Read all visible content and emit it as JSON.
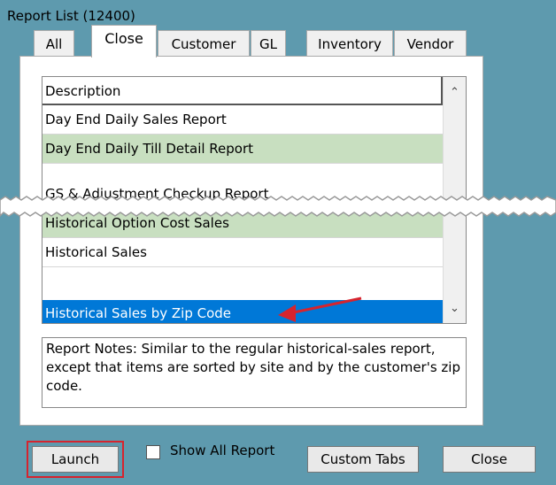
{
  "window": {
    "title": "Report List (12400)"
  },
  "tabs": [
    {
      "label": "All"
    },
    {
      "label": "Close"
    },
    {
      "label": "Customer"
    },
    {
      "label": "GL"
    },
    {
      "label": "Inventory"
    },
    {
      "label": "Vendor"
    }
  ],
  "list": {
    "header": "Description",
    "rows": [
      {
        "label": "Day End Daily Sales Report",
        "style": "white"
      },
      {
        "label": "Day End Daily Till Detail Report",
        "style": "green"
      },
      {
        "label": "GS & Adjustment Checkup Report",
        "style": "white"
      },
      {
        "label": "Historical Option Cost Sales",
        "style": "green"
      },
      {
        "label": "Historical Sales",
        "style": "white"
      },
      {
        "label": "Historical Sales by Zip Code",
        "style": "selected"
      }
    ]
  },
  "notes": {
    "text": "Report Notes:  Similar to the regular historical-sales report, except that items are sorted by site and by the customer's zip code."
  },
  "buttons": {
    "launch": "Launch",
    "show_all": "Show All Report",
    "custom_tabs": "Custom Tabs",
    "close": "Close"
  },
  "colors": {
    "title_bg": "#5e9aae",
    "row_green": "#c8dfc0",
    "row_selected": "#0078d7",
    "highlight_red": "#d6242e"
  }
}
